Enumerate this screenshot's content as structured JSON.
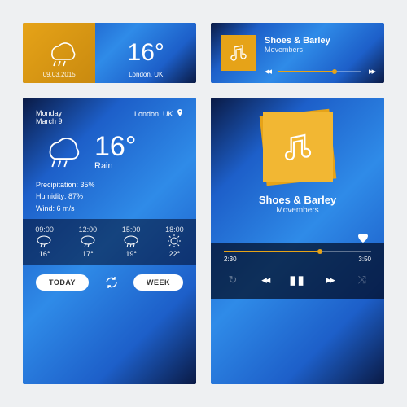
{
  "colors": {
    "accent": "#e6a318"
  },
  "weather_small": {
    "temp": "16°",
    "date": "09.03.2015",
    "location": "London, UK"
  },
  "music_small": {
    "title": "Shoes & Barley",
    "artist": "Movembers",
    "progress_pct": 68
  },
  "weather_big": {
    "day": "Monday",
    "date": "March 9",
    "location": "London, UK",
    "temp": "16°",
    "condition": "Rain",
    "precip_label": "Precipitation: 35%",
    "humidity_label": "Humidity: 87%",
    "wind_label": "Wind: 6 m/s",
    "forecast": [
      {
        "time": "09:00",
        "temp": "16°",
        "icon": "rain"
      },
      {
        "time": "12:00",
        "temp": "17°",
        "icon": "rain"
      },
      {
        "time": "15:00",
        "temp": "19°",
        "icon": "shower"
      },
      {
        "time": "18:00",
        "temp": "22°",
        "icon": "sun"
      }
    ],
    "today_btn": "TODAY",
    "week_btn": "WEEK"
  },
  "music_big": {
    "title": "Shoes & Barley",
    "artist": "Movembers",
    "elapsed": "2:30",
    "total": "3:50",
    "progress_pct": 65
  }
}
